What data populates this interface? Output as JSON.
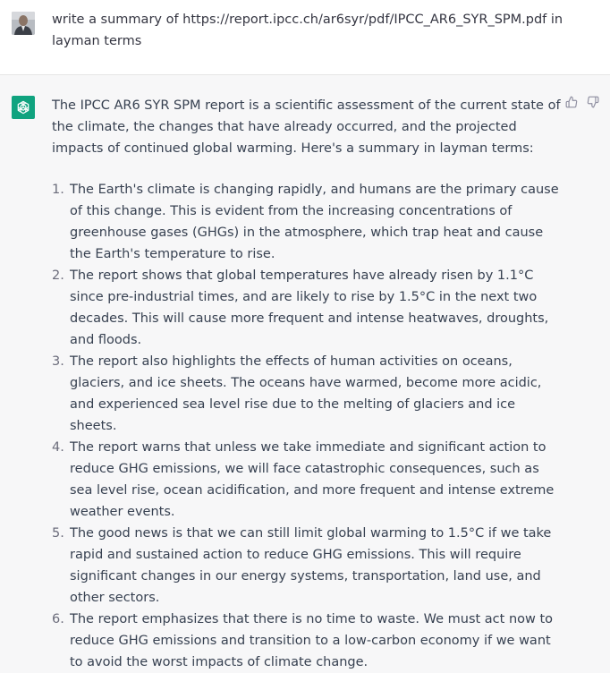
{
  "user_message": {
    "text": "write a summary of https://report.ipcc.ch/ar6syr/pdf/IPCC_AR6_SYR_SPM.pdf in layman terms"
  },
  "assistant_message": {
    "intro": "The IPCC AR6 SYR SPM report is a scientific assessment of the current state of the climate, the changes that have already occurred, and the projected impacts of continued global warming. Here's a summary in layman terms:",
    "items": [
      {
        "number": "1.",
        "text": "The Earth's climate is changing rapidly, and humans are the primary cause of this change. This is evident from the increasing concentrations of greenhouse gases (GHGs) in the atmosphere, which trap heat and cause the Earth's temperature to rise."
      },
      {
        "number": "2.",
        "text": "The report shows that global temperatures have already risen by 1.1°C since pre-industrial times, and are likely to rise by 1.5°C in the next two decades. This will cause more frequent and intense heatwaves, droughts, and floods."
      },
      {
        "number": "3.",
        "text": "The report also highlights the effects of human activities on oceans, glaciers, and ice sheets. The oceans have warmed, become more acidic, and experienced sea level rise due to the melting of glaciers and ice sheets."
      },
      {
        "number": "4.",
        "text": "The report warns that unless we take immediate and significant action to reduce GHG emissions, we will face catastrophic consequences, such as sea level rise, ocean acidification, and more frequent and intense extreme weather events."
      },
      {
        "number": "5.",
        "text": "The good news is that we can still limit global warming to 1.5°C if we take rapid and sustained action to reduce GHG emissions. This will require significant changes in our energy systems, transportation, land use, and other sectors."
      },
      {
        "number": "6.",
        "text": "The report emphasizes that there is no time to waste. We must act now to reduce GHG emissions and transition to a low-carbon economy if we want to avoid the worst impacts of climate change."
      }
    ]
  },
  "icons": {
    "user_avatar": "user-avatar-photo",
    "assistant_avatar": "openai-logo-icon",
    "thumbs_up": "thumbs-up-icon",
    "thumbs_down": "thumbs-down-icon"
  },
  "colors": {
    "assistant_avatar_bg": "#10a37f",
    "user_row_bg": "#ffffff",
    "assistant_row_bg": "#f7f7f8",
    "text": "#374151"
  }
}
